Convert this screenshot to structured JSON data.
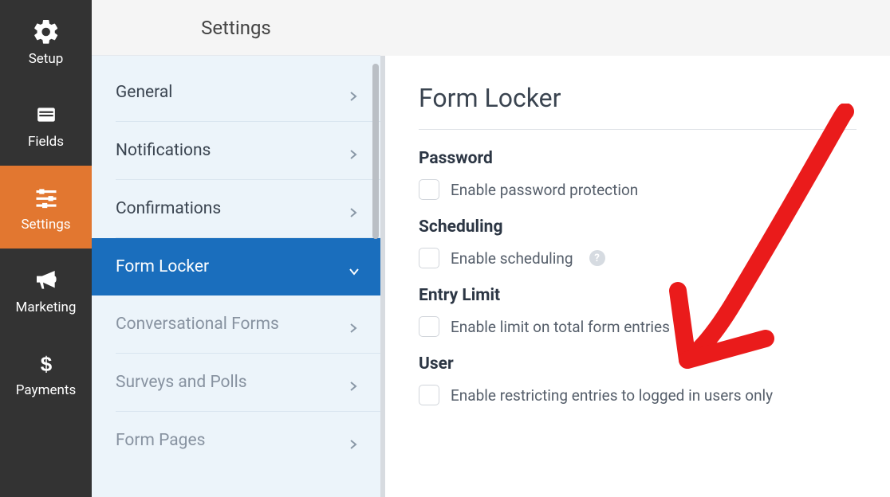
{
  "header": {
    "title": "Settings"
  },
  "iconSidebar": {
    "items": [
      {
        "label": "Setup"
      },
      {
        "label": "Fields"
      },
      {
        "label": "Settings"
      },
      {
        "label": "Marketing"
      },
      {
        "label": "Payments"
      }
    ]
  },
  "submenu": {
    "items": [
      {
        "label": "General"
      },
      {
        "label": "Notifications"
      },
      {
        "label": "Confirmations"
      },
      {
        "label": "Form Locker"
      },
      {
        "label": "Conversational Forms"
      },
      {
        "label": "Surveys and Polls"
      },
      {
        "label": "Form Pages"
      }
    ]
  },
  "panel": {
    "title": "Form Locker",
    "sections": {
      "password": {
        "heading": "Password",
        "checkbox": "Enable password protection"
      },
      "scheduling": {
        "heading": "Scheduling",
        "checkbox": "Enable scheduling"
      },
      "entryLimit": {
        "heading": "Entry Limit",
        "checkbox": "Enable limit on total form entries"
      },
      "user": {
        "heading": "User",
        "checkbox": "Enable restricting entries to logged in users only"
      }
    }
  }
}
